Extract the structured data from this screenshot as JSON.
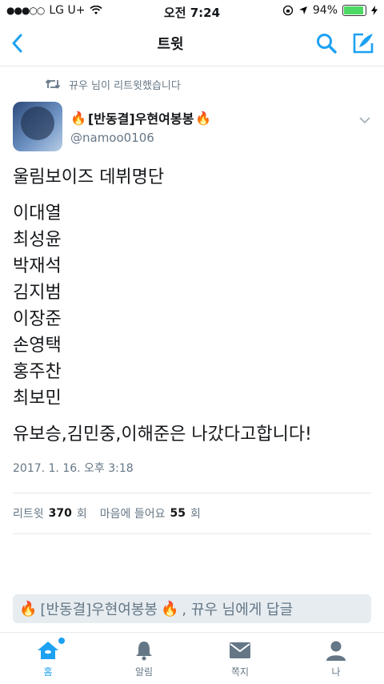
{
  "status_bar": {
    "carrier": "LG U+",
    "time": "오전 7:24",
    "battery": "94%",
    "battery_level": 0.94
  },
  "nav": {
    "title": "트윗"
  },
  "retweet_notice": "뀨우 님이 리트윗했습니다",
  "author": {
    "name": "[반동결]우현여봉봉",
    "handle": "@namoo0106"
  },
  "tweet": {
    "headline": "울림보이즈 데뷔명단",
    "members": [
      "이대열",
      "최성윤",
      "박재석",
      "김지범",
      "이장준",
      "손영택",
      "홍주찬",
      "최보민"
    ],
    "footer_line": "유보승,김민중,이해준은 나갔다고합니다!"
  },
  "timestamp": "2017. 1. 16. 오후 3:18",
  "stats": {
    "retweets_label": "리트윗",
    "retweets": "370",
    "retweets_unit": "회",
    "likes_label": "마음에 들어요",
    "likes": "55",
    "likes_unit": "회"
  },
  "reply": {
    "name": "[반동결]우현여봉봉",
    "suffix": ", 뀨우 님에게 답글"
  },
  "tabs": [
    {
      "label": "홈",
      "icon": "home-icon"
    },
    {
      "label": "알림",
      "icon": "bell-icon"
    },
    {
      "label": "쪽지",
      "icon": "envelope-icon"
    },
    {
      "label": "나",
      "icon": "person-icon"
    }
  ],
  "colors": {
    "accent": "#1da1f2",
    "muted": "#657786",
    "battery": "#4cd964"
  }
}
